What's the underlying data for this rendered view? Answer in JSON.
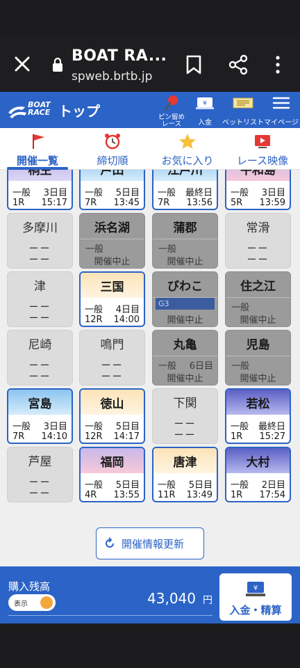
{
  "browser": {
    "site_title": "BOAT RA...",
    "url": "spweb.brtb.jp"
  },
  "header": {
    "logo_text_1": "BOAT",
    "logo_text_2": "RACE",
    "title": "トップ",
    "buttons": {
      "pin": "ピン留め\nレース",
      "deposit": "入金",
      "betlist": "ベットリスト",
      "mypage": "マイページ"
    }
  },
  "tabs": [
    {
      "label": "開催一覧",
      "icon": "flag-icon",
      "active": true
    },
    {
      "label": "締切順",
      "icon": "alarm-clock-icon",
      "active": false
    },
    {
      "label": "お気に入り",
      "icon": "star-icon",
      "active": false
    },
    {
      "label": "レース映像",
      "icon": "video-icon",
      "active": false
    }
  ],
  "venues": [
    {
      "name": "桐生",
      "state": "active",
      "grade": "一般",
      "day": "3日目",
      "race": "1R",
      "time": "15:17",
      "theme": "purple"
    },
    {
      "name": "戸田",
      "state": "active",
      "grade": "一般",
      "day": "5日目",
      "race": "7R",
      "time": "13:45",
      "theme": "sky"
    },
    {
      "name": "江戸川",
      "state": "active",
      "grade": "一般",
      "day": "最終日",
      "race": "7R",
      "time": "13:56",
      "theme": "sky"
    },
    {
      "name": "平和島",
      "state": "active",
      "grade": "一般",
      "day": "3日目",
      "race": "5R",
      "time": "13:59",
      "theme": "pink"
    },
    {
      "name": "多摩川",
      "state": "inactive",
      "dash": "ーー"
    },
    {
      "name": "浜名湖",
      "state": "cancel",
      "grade": "一般",
      "status": "開催中止"
    },
    {
      "name": "蒲郡",
      "state": "cancel",
      "grade": "一般",
      "status": "開催中止"
    },
    {
      "name": "常滑",
      "state": "inactive",
      "dash": "ーー"
    },
    {
      "name": "津",
      "state": "inactive",
      "dash": "ーー"
    },
    {
      "name": "三国",
      "state": "active",
      "grade": "一般",
      "day": "4日目",
      "race": "12R",
      "time": "14:00",
      "theme": "sunrise"
    },
    {
      "name": "びわこ",
      "state": "cancel",
      "grade": "G3",
      "status": "開催中止"
    },
    {
      "name": "住之江",
      "state": "cancel",
      "grade": "一般",
      "status": "開催中止"
    },
    {
      "name": "尼崎",
      "state": "inactive",
      "dash": "ーー"
    },
    {
      "name": "鳴門",
      "state": "inactive",
      "dash": "ーー"
    },
    {
      "name": "丸亀",
      "state": "cancel",
      "grade": "一般",
      "day": "6日目",
      "status": "開催中止"
    },
    {
      "name": "児島",
      "state": "cancel",
      "grade": "一般",
      "status": "開催中止"
    },
    {
      "name": "宮島",
      "state": "active",
      "grade": "一般",
      "day": "3日目",
      "race": "7R",
      "time": "14:10",
      "theme": "sky"
    },
    {
      "name": "徳山",
      "state": "active",
      "grade": "一般",
      "day": "5日目",
      "race": "12R",
      "time": "14:17",
      "theme": "sunrise"
    },
    {
      "name": "下関",
      "state": "inactive",
      "dash": "ーー"
    },
    {
      "name": "若松",
      "state": "active",
      "grade": "一般",
      "day": "最終日",
      "race": "1R",
      "time": "15:27",
      "theme": "night"
    },
    {
      "name": "芦屋",
      "state": "inactive",
      "dash": "ーー"
    },
    {
      "name": "福岡",
      "state": "active",
      "grade": "一般",
      "day": "5日目",
      "race": "4R",
      "time": "13:55",
      "theme": "pink"
    },
    {
      "name": "唐津",
      "state": "active",
      "grade": "一般",
      "day": "5日目",
      "race": "11R",
      "time": "13:49",
      "theme": "sunrise"
    },
    {
      "name": "大村",
      "state": "active",
      "grade": "一般",
      "day": "2日目",
      "race": "1R",
      "time": "17:54",
      "theme": "night"
    }
  ],
  "refresh_label": "開催情報更新",
  "balance": {
    "label": "購入残高",
    "toggle_label": "表示",
    "amount": "43,040",
    "unit": "円",
    "deposit_button": "入金・精算"
  },
  "colors": {
    "brand_blue": "#2b63c6",
    "toggle_knob": "#f3a73a",
    "cancel_gray": "#9b9b9b",
    "inactive_gray": "#dcdcdc"
  }
}
